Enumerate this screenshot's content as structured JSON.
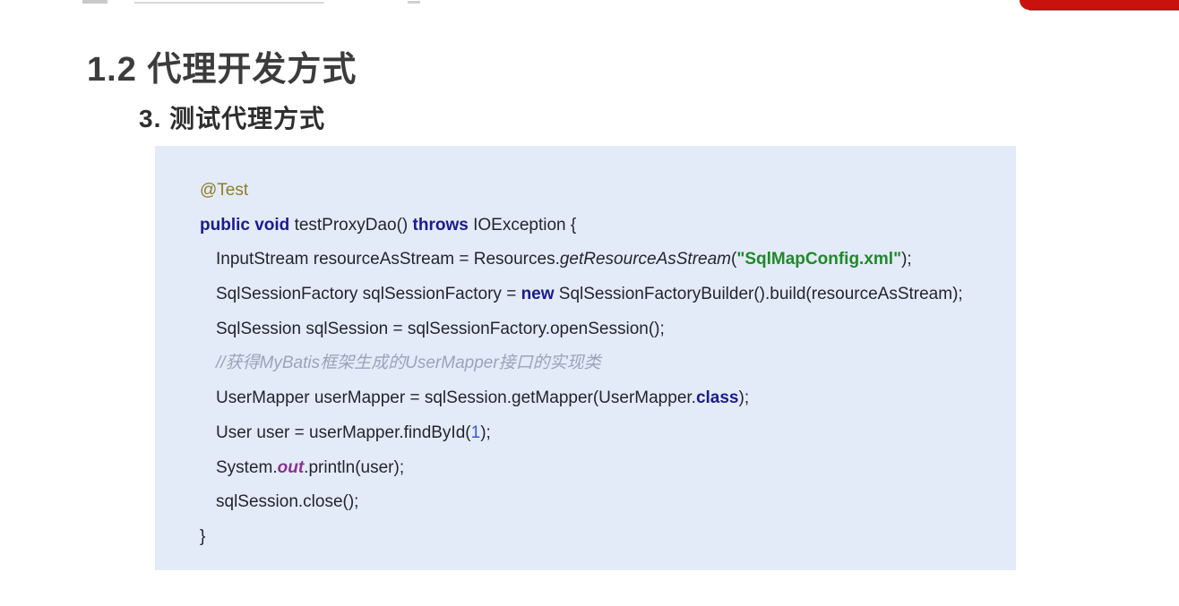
{
  "page": {
    "title": "1.2 代理开发方式",
    "subtitle": "3. 测试代理方式"
  },
  "decorations": {
    "top_right_bar_color": "#c9120e",
    "code_block_background": "#e3ebf9"
  },
  "code_block": {
    "language": "java",
    "lines": [
      {
        "indent": "outer",
        "tokens": [
          {
            "text": "@Test",
            "style": "annotation"
          }
        ]
      },
      {
        "indent": "outer",
        "tokens": [
          {
            "text": "public void ",
            "style": "keyword"
          },
          {
            "text": "testProxyDao() ",
            "style": "plain"
          },
          {
            "text": "throws ",
            "style": "keyword"
          },
          {
            "text": "IOException {",
            "style": "plain"
          }
        ]
      },
      {
        "indent": "inner",
        "tokens": [
          {
            "text": "InputStream resourceAsStream = Resources.",
            "style": "plain"
          },
          {
            "text": "getResourceAsStream",
            "style": "method"
          },
          {
            "text": "(",
            "style": "plain"
          },
          {
            "text": "\"SqlMapConfig.xml\"",
            "style": "string"
          },
          {
            "text": ");",
            "style": "plain"
          }
        ]
      },
      {
        "indent": "inner",
        "tokens": [
          {
            "text": "SqlSessionFactory sqlSessionFactory = ",
            "style": "plain"
          },
          {
            "text": "new ",
            "style": "keyword"
          },
          {
            "text": "SqlSessionFactoryBuilder().build(resourceAsStream);",
            "style": "plain"
          }
        ]
      },
      {
        "indent": "inner",
        "tokens": [
          {
            "text": "SqlSession sqlSession = sqlSessionFactory.openSession();",
            "style": "plain"
          }
        ]
      },
      {
        "indent": "inner",
        "tokens": [
          {
            "text": "//获得MyBatis框架生成的UserMapper接口的实现类",
            "style": "comment"
          }
        ]
      },
      {
        "indent": "inner",
        "tokens": [
          {
            "text": "UserMapper userMapper = sqlSession.getMapper(UserMapper.",
            "style": "plain"
          },
          {
            "text": "class",
            "style": "keyword"
          },
          {
            "text": ");",
            "style": "plain"
          }
        ]
      },
      {
        "indent": "inner",
        "tokens": [
          {
            "text": "User user = userMapper.findById(",
            "style": "plain"
          },
          {
            "text": "1",
            "style": "number"
          },
          {
            "text": ");",
            "style": "plain"
          }
        ]
      },
      {
        "indent": "inner",
        "tokens": [
          {
            "text": "System.",
            "style": "plain"
          },
          {
            "text": "out",
            "style": "field"
          },
          {
            "text": ".println(user);",
            "style": "plain"
          }
        ]
      },
      {
        "indent": "inner",
        "tokens": [
          {
            "text": "sqlSession.close();",
            "style": "plain"
          }
        ]
      },
      {
        "indent": "outer",
        "tokens": [
          {
            "text": "}",
            "style": "plain"
          }
        ]
      }
    ]
  }
}
